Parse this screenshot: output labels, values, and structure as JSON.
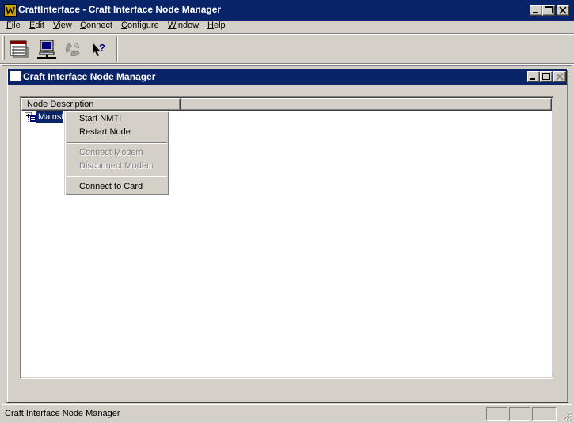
{
  "window": {
    "title": "CraftInterface - Craft Interface Node Manager",
    "icon": "craft-app-icon"
  },
  "menubar": {
    "items": [
      {
        "label": "File",
        "mnemonic": "F",
        "rest": "ile"
      },
      {
        "label": "Edit",
        "mnemonic": "E",
        "rest": "dit"
      },
      {
        "label": "View",
        "mnemonic": "V",
        "rest": "iew"
      },
      {
        "label": "Connect",
        "mnemonic": "C",
        "rest": "onnect"
      },
      {
        "label": "Configure",
        "mnemonic": "C",
        "rest": "onfigure"
      },
      {
        "label": "Window",
        "mnemonic": "W",
        "rest": "indow"
      },
      {
        "label": "Help",
        "mnemonic": "H",
        "rest": "elp"
      }
    ]
  },
  "toolbar": {
    "buttons": [
      {
        "icon": "node-manager-icon"
      },
      {
        "icon": "network-computer-icon"
      },
      {
        "icon": "modem-phone-icon",
        "disabled": true
      },
      {
        "icon": "context-help-icon"
      }
    ]
  },
  "child_window": {
    "title": "Craft Interface Node Manager"
  },
  "tree": {
    "column_header": "Node Description",
    "nodes": [
      {
        "label": "Mainst",
        "selected": true
      }
    ]
  },
  "context_menu": {
    "items": [
      {
        "label": "Start NMTI",
        "enabled": true
      },
      {
        "label": "Restart Node",
        "enabled": true
      },
      {
        "label": "Connect Modem",
        "enabled": false
      },
      {
        "label": "Disconnect Modem",
        "enabled": false
      },
      {
        "label": "Connect to Card",
        "enabled": true
      }
    ]
  },
  "statusbar": {
    "text": "Craft Interface Node Manager"
  },
  "colors": {
    "titlebar_active": "#0a246a",
    "face": "#d4d0c8",
    "selection": "#0a246a"
  }
}
